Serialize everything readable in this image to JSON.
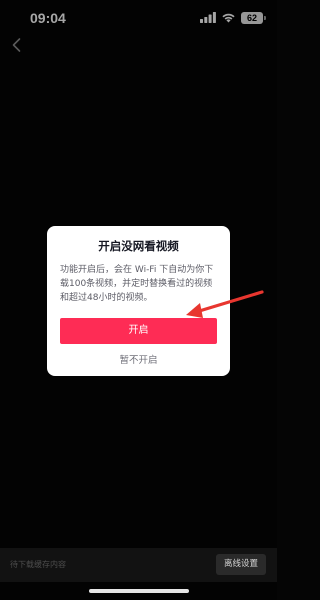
{
  "status_bar": {
    "time": "09:04",
    "battery": "62",
    "icons": [
      "signal-icon",
      "wifi-icon",
      "battery-icon"
    ]
  },
  "nav": {
    "back_icon": "chevron-left-icon"
  },
  "dialog": {
    "title": "开启没网看视频",
    "body": "功能开启后，会在 Wi-Fi 下自动为你下载100条视频，并定时替换看过的视频和超过48小时的视频。",
    "confirm_label": "开启",
    "cancel_label": "暂不开启"
  },
  "bottom_bar": {
    "pending_text": "待下载缓存内容",
    "offline_settings_label": "离线设置"
  },
  "colors": {
    "accent": "#fe2c55",
    "arrow": "#e8362f",
    "background": "#050505"
  }
}
